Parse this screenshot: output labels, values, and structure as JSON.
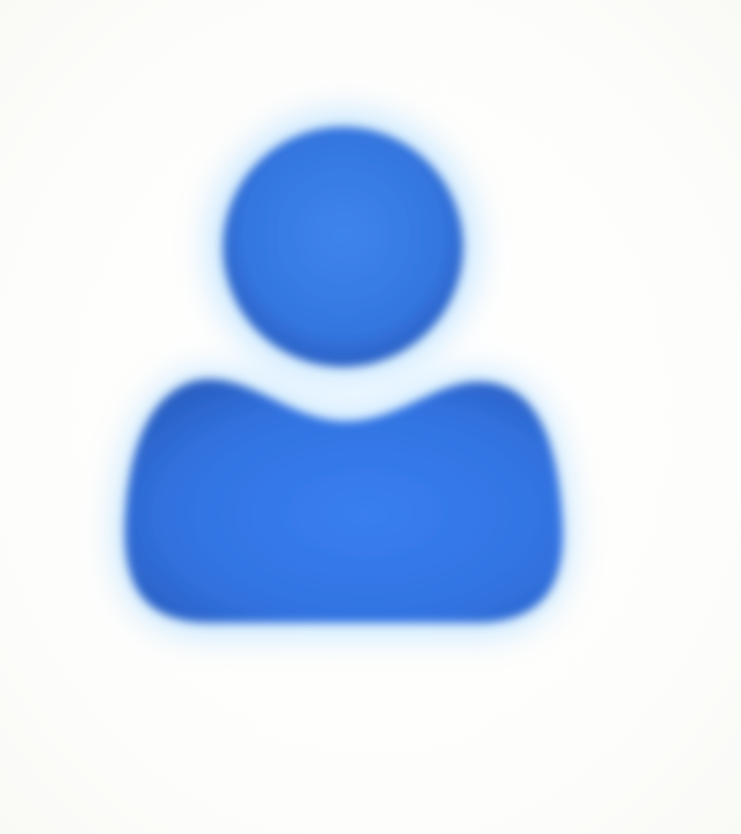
{
  "icon": {
    "name": "user-icon",
    "fill_color": "#3476e0",
    "edge_color": "#2a60c4",
    "halo_color": "#bfe3ff"
  }
}
